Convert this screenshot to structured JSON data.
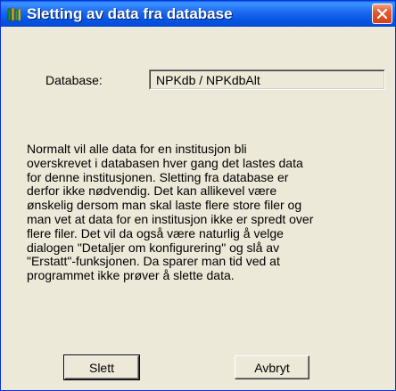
{
  "window": {
    "title": "Sletting av data fra database",
    "icon": "books-icon",
    "close_icon": "close-icon"
  },
  "database": {
    "label": "Database:",
    "value": "NPKdb / NPKdbAlt"
  },
  "info_lines": [
    "Normalt vil alle data for en institusjon bli",
    "overskrevet i databasen hver gang det lastes data",
    "for denne institusjonen.  Sletting fra database er",
    "derfor ikke nødvendig.  Det kan allikevel være",
    "ønskelig dersom man skal laste flere store filer og",
    "man vet at data for en institusjon ikke er spredt over",
    "flere filer.  Det vil da også være naturlig å velge",
    "dialogen \"Detaljer om konfigurering\" og slå av",
    "\"Erstatt\"-funksjonen.  Da sparer man tid ved at",
    "programmet ikke prøver å slette data."
  ],
  "buttons": {
    "slett": "Slett",
    "avbryt": "Avbryt"
  },
  "colors": {
    "titlebar": "#0554e3",
    "close": "#d5401a",
    "dialog_bg": "#ece9d8"
  }
}
